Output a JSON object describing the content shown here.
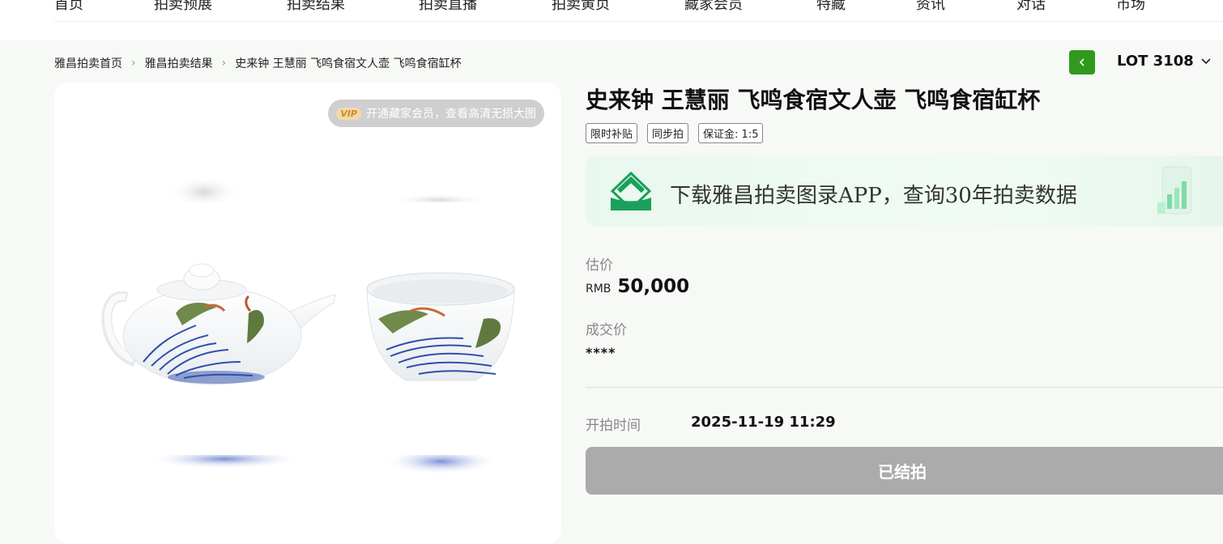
{
  "nav": {
    "items": [
      "首页",
      "拍卖预展",
      "拍卖结果",
      "拍卖直播",
      "拍卖黄页",
      "藏家会员",
      "特藏",
      "资讯",
      "对话",
      "市场"
    ]
  },
  "breadcrumb": [
    "雅昌拍卖首页",
    "雅昌拍卖结果",
    "史来钟 王慧丽 飞鸣食宿文人壶 飞鸣食宿缸杯"
  ],
  "lot": {
    "label": "LOT 3108"
  },
  "image_card": {
    "vip_badge": "VIP",
    "vip_text": "开通藏家会员，查看高清无损大图"
  },
  "lot_info": {
    "title": "史来钟 王慧丽 飞鸣食宿文人壶 飞鸣食宿缸杯",
    "tags": [
      "限时补贴",
      "同步拍",
      "保证金: 1:5"
    ],
    "app_banner_text": "下载雅昌拍卖图录APP，查询30年拍卖数据",
    "estimate_label": "估价",
    "currency": "RMB",
    "estimate_value": "50,000",
    "deal_label": "成交价",
    "deal_value": "****",
    "start_label": "开拍时间",
    "start_value": "2025-11-19 11:29",
    "status_button": "已结拍"
  },
  "colors": {
    "accent_green": "#2f9a1e",
    "ended_button": "#ababab",
    "page_bg": "#f7f9f6"
  }
}
